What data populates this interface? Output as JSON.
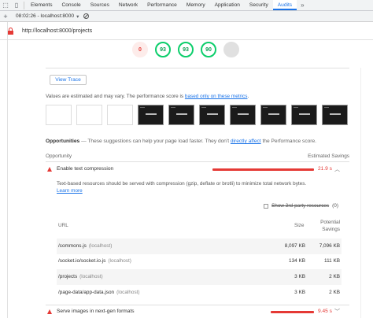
{
  "devtools": {
    "tabs": [
      "Elements",
      "Console",
      "Sources",
      "Network",
      "Performance",
      "Memory",
      "Application",
      "Security",
      "Audits"
    ],
    "active_tab": "Audits",
    "more_label": "»",
    "audit_selector": "08:02:26 - localhost:8000",
    "add_label": "+"
  },
  "url": "http://localhost:8000/projects",
  "scores": [
    {
      "label": "0",
      "color": "#e53935"
    },
    {
      "label": "93",
      "color": "#0cce6b"
    },
    {
      "label": "93",
      "color": "#0cce6b"
    },
    {
      "label": "90",
      "color": "#0cce6b"
    },
    {
      "label": "",
      "color": "#e0e0e0"
    }
  ],
  "view_trace_label": "View Trace",
  "estimated": {
    "text": "Values are estimated and may vary. The performance score is ",
    "link": "based only on these metrics",
    "end": "."
  },
  "filmstrip": [
    "blank",
    "blank",
    "blank",
    "dark",
    "dark",
    "dark",
    "dark",
    "dark",
    "dark",
    "dark"
  ],
  "opportunities": {
    "title": "Opportunities",
    "dash": "—",
    "desc": "These suggestions can help your page load faster. They don't ",
    "link": "directly affect",
    "desc_end": " the Performance score.",
    "col_left": "Opportunity",
    "col_right": "Estimated Savings"
  },
  "items": [
    {
      "title": "Enable text compression",
      "savings": "21.9 s",
      "bar_fraction": 0.98
    },
    {
      "title": "Serve images in next-gen formats",
      "savings": "9.45 s",
      "bar_fraction": 0.42
    }
  ],
  "detail": {
    "description": "Text-based resources should be served with compression (gzip, deflate or brotli) to minimize total network bytes. ",
    "link": "Learn more",
    "third_party_label": "Show 3rd-party resources",
    "third_party_count": "(0)",
    "columns": {
      "url": "URL",
      "size": "Size",
      "potential_1": "Potential",
      "potential_2": "Savings"
    },
    "rows": [
      {
        "url": "/commons.js",
        "host": "(localhost)",
        "size": "8,097 KB",
        "savings": "7,096 KB"
      },
      {
        "url": "/socket.io/socket.io.js",
        "host": "(localhost)",
        "size": "134 KB",
        "savings": "111 KB"
      },
      {
        "url": "/projects",
        "host": "(localhost)",
        "size": "3 KB",
        "savings": "2 KB"
      },
      {
        "url": "/page-data/app-data.json",
        "host": "(localhost)",
        "size": "3 KB",
        "savings": "2 KB"
      }
    ]
  }
}
